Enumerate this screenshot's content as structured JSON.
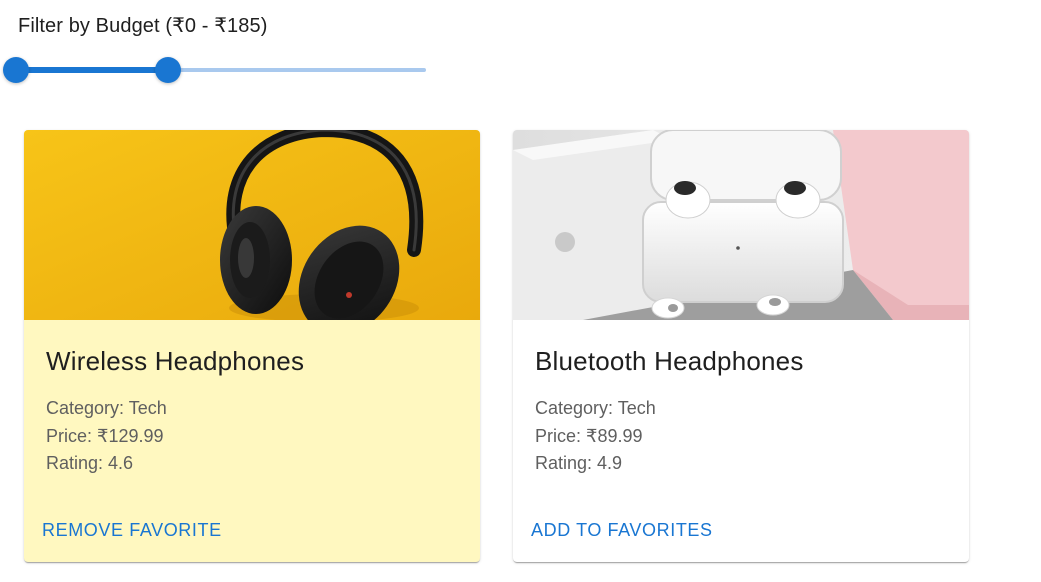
{
  "filter": {
    "label": "Filter by Budget (₹0 - ₹185)",
    "min": 0,
    "max": 500,
    "value_low": 0,
    "value_high": 185
  },
  "colors": {
    "accent": "#1976d2",
    "rail": "#a9c9ee",
    "favorite_card_bg": "#fff8c0"
  },
  "products": [
    {
      "title": "Wireless Headphones",
      "category": "Category: Tech",
      "price": "Price: ₹129.99",
      "rating": "Rating: 4.6",
      "action": "REMOVE FAVORITE",
      "favorite": true,
      "image_icon": "headphones-photo"
    },
    {
      "title": "Bluetooth Headphones",
      "category": "Category: Tech",
      "price": "Price: ₹89.99",
      "rating": "Rating: 4.9",
      "action": "ADD TO FAVORITES",
      "favorite": false,
      "image_icon": "earbuds-photo"
    }
  ]
}
